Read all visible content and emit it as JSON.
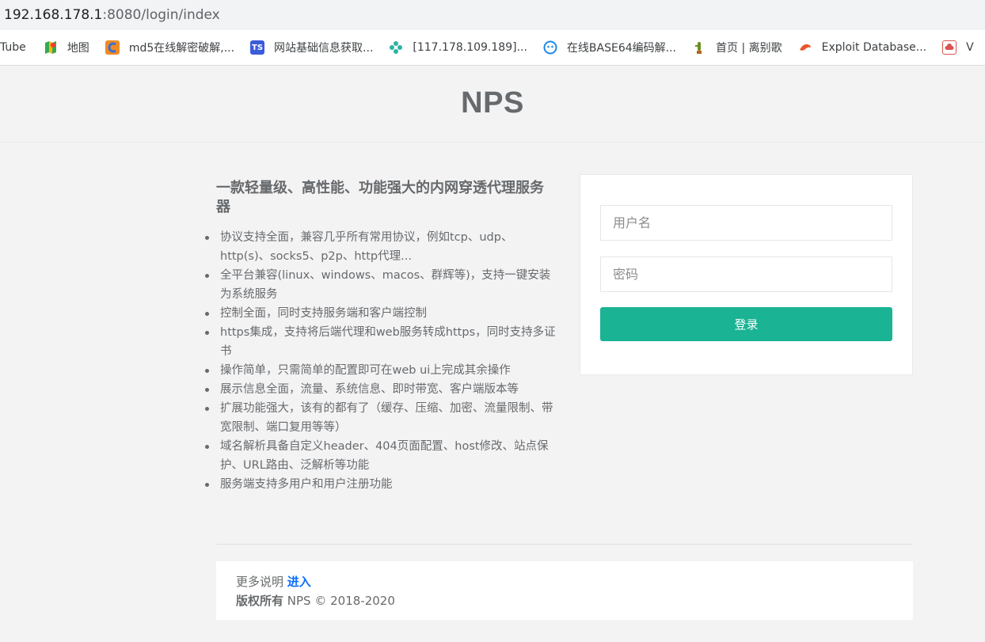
{
  "browser": {
    "url_host": "192.168.178.1",
    "url_path": ":8080/login/index",
    "bookmarks": [
      {
        "label": "Tube",
        "icon": "youtube-icon"
      },
      {
        "label": "地图",
        "icon": "maps-icon",
        "color": "#34a853"
      },
      {
        "label": "md5在线解密破解,...",
        "icon": "cmd5-icon",
        "color": "#f08a24"
      },
      {
        "label": "网站基础信息获取...",
        "icon": "ts-icon",
        "color": "#3b5bdb"
      },
      {
        "label": "[117.178.109.189]...",
        "icon": "gear-flower-icon",
        "color": "#2bb3a3"
      },
      {
        "label": "在线BASE64编码解...",
        "icon": "base64-icon",
        "color": "#1e88e5"
      },
      {
        "label": "首页 | 离别歌",
        "icon": "cactus-icon",
        "color": "#6b8e23"
      },
      {
        "label": "Exploit Database...",
        "icon": "exploit-db-icon",
        "color": "#e8552a"
      },
      {
        "label": "V",
        "icon": "cloud-icon",
        "color": "#d9534f"
      }
    ]
  },
  "header": {
    "title": "NPS"
  },
  "intro": {
    "title": "一款轻量级、高性能、功能强大的内网穿透代理服务器",
    "features": [
      "协议支持全面，兼容几乎所有常用协议，例如tcp、udp、http(s)、socks5、p2p、http代理...",
      "全平台兼容(linux、windows、macos、群辉等)，支持一键安装为系统服务",
      "控制全面，同时支持服务端和客户端控制",
      "https集成，支持将后端代理和web服务转成https，同时支持多证书",
      "操作简单，只需简单的配置即可在web ui上完成其余操作",
      "展示信息全面，流量、系统信息、即时带宽、客户端版本等",
      "扩展功能强大，该有的都有了（缓存、压缩、加密、流量限制、带宽限制、端口复用等等）",
      "域名解析具备自定义header、404页面配置、host修改、站点保护、URL路由、泛解析等功能",
      "服务端支持多用户和用户注册功能"
    ]
  },
  "login": {
    "username_placeholder": "用户名",
    "password_placeholder": "密码",
    "submit_label": "登录",
    "accent": "#1ab394"
  },
  "footer": {
    "more_text": "更多说明",
    "more_link": "进入",
    "copyright_bold": "版权所有",
    "copyright_text": " NPS © 2018-2020"
  }
}
